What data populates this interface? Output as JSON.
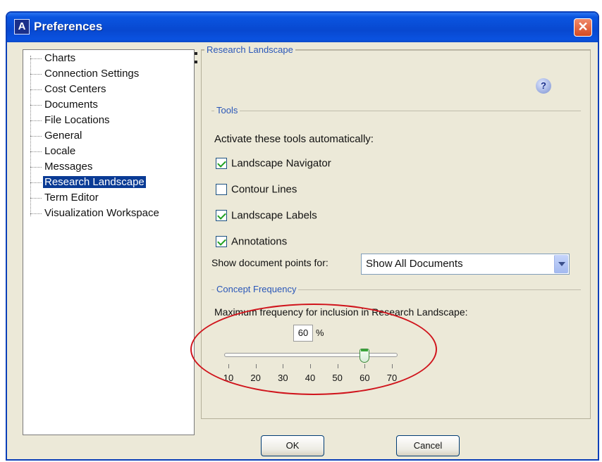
{
  "window": {
    "title": "Preferences",
    "app_icon_glyph": "A",
    "close_glyph": "✕"
  },
  "tree": {
    "items": [
      {
        "label": "Charts",
        "selected": false
      },
      {
        "label": "Connection Settings",
        "selected": false
      },
      {
        "label": "Cost Centers",
        "selected": false
      },
      {
        "label": "Documents",
        "selected": false
      },
      {
        "label": "File Locations",
        "selected": false
      },
      {
        "label": "General",
        "selected": false
      },
      {
        "label": "Locale",
        "selected": false
      },
      {
        "label": "Messages",
        "selected": false
      },
      {
        "label": "Research Landscape",
        "selected": true
      },
      {
        "label": "Term Editor",
        "selected": false
      },
      {
        "label": "Visualization Workspace",
        "selected": false
      }
    ]
  },
  "panel": {
    "title": "Research Landscape",
    "help_glyph": "?",
    "tools": {
      "legend": "Tools",
      "intro": "Activate these tools automatically:",
      "options": [
        {
          "label": "Landscape Navigator",
          "checked": true
        },
        {
          "label": "Contour Lines",
          "checked": false
        },
        {
          "label": "Landscape Labels",
          "checked": true
        },
        {
          "label": "Annotations",
          "checked": true
        }
      ],
      "doc_points_label": "Show document points for:",
      "doc_points_value": "Show All Documents"
    },
    "concept": {
      "legend": "Concept Frequency",
      "max_label": "Maximum frequency for inclusion in Research Landscape:",
      "value": "60",
      "unit": "%",
      "slider": {
        "min": 10,
        "max": 70,
        "value": 60,
        "ticks": [
          "10",
          "20",
          "30",
          "40",
          "50",
          "60",
          "70"
        ]
      }
    }
  },
  "buttons": {
    "ok": "OK",
    "cancel": "Cancel"
  },
  "colors": {
    "title_bar": "#0a55e0",
    "selection": "#0a3b95",
    "legend_text": "#2a57b8",
    "annotation": "#d0141c"
  }
}
